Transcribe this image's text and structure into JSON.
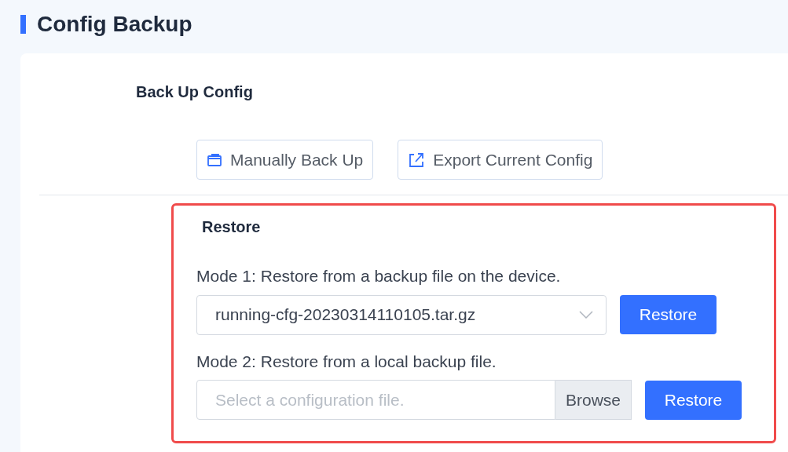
{
  "page_title": "Config Backup",
  "backup": {
    "heading": "Back Up Config",
    "buttons": [
      {
        "label": "Manually Back Up",
        "kind": "backup"
      },
      {
        "label": "Export Current Config",
        "kind": "export"
      }
    ]
  },
  "restore": {
    "heading": "Restore",
    "highlighted": true,
    "mode1": {
      "label": "Mode 1: Restore from a backup file on the device.",
      "value": "running-cfg-20230314110105.tar.gz",
      "button": "Restore"
    },
    "mode2": {
      "label": "Mode 2: Restore from a local backup file.",
      "placeholder": "Select a configuration file.",
      "browse": "Browse",
      "button": "Restore"
    }
  }
}
